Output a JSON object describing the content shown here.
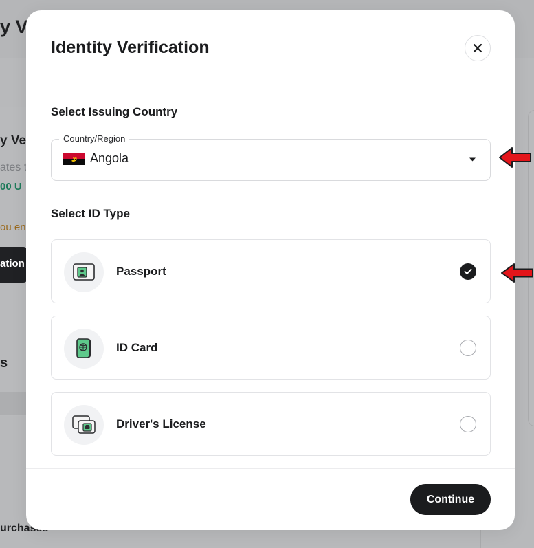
{
  "background": {
    "title_fragment": "y Ve",
    "card_heading_fragment": "y Ve",
    "muted_fragment": "ates t",
    "green_fragment": "00 U",
    "orange_fragment": "ou en",
    "button_fragment": "ation",
    "section_fragment": "s",
    "purchases_fragment": "urchases"
  },
  "modal": {
    "title": "Identity Verification",
    "close_icon": "close-icon",
    "country_section_label": "Select Issuing Country",
    "country_select": {
      "legend": "Country/Region",
      "value": "Angola",
      "flag_icon": "angola-flag-icon",
      "caret_icon": "caret-down-icon"
    },
    "id_section_label": "Select ID Type",
    "id_types": [
      {
        "label": "Passport",
        "icon": "passport-icon",
        "selected": true
      },
      {
        "label": "ID Card",
        "icon": "id-card-icon",
        "selected": false
      },
      {
        "label": "Driver's License",
        "icon": "drivers-license-icon",
        "selected": false
      }
    ],
    "continue_label": "Continue"
  },
  "colors": {
    "accent_dark": "#1b1c1e",
    "annotation_arrow": "#e3151a",
    "icon_green": "#5ec98b"
  }
}
